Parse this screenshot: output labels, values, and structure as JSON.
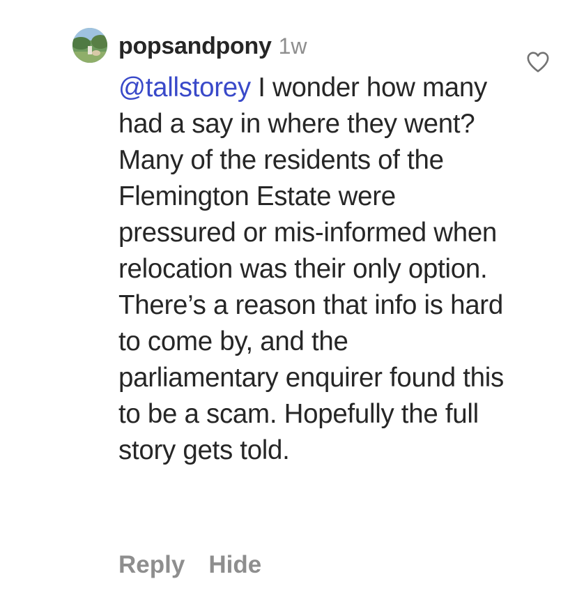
{
  "comment": {
    "username": "popsandpony",
    "timestamp": "1w",
    "mention": "@tallstorey",
    "text": " I wonder how many had a say in where they went? Many of the residents of the Flemington Estate were pressured or mis-informed when relocation was their only option. There’s a reason that info is hard to come by, and the parliamentary enquirer found this to be a scam. Hopefully the full story gets told.",
    "like_icon": "heart-outline-icon",
    "avatar_icon": "profile-avatar"
  },
  "actions": {
    "reply_label": "Reply",
    "hide_label": "Hide"
  },
  "colors": {
    "mention": "#3949c9",
    "secondary_text": "#8e8e8e",
    "primary_text": "#262626"
  }
}
